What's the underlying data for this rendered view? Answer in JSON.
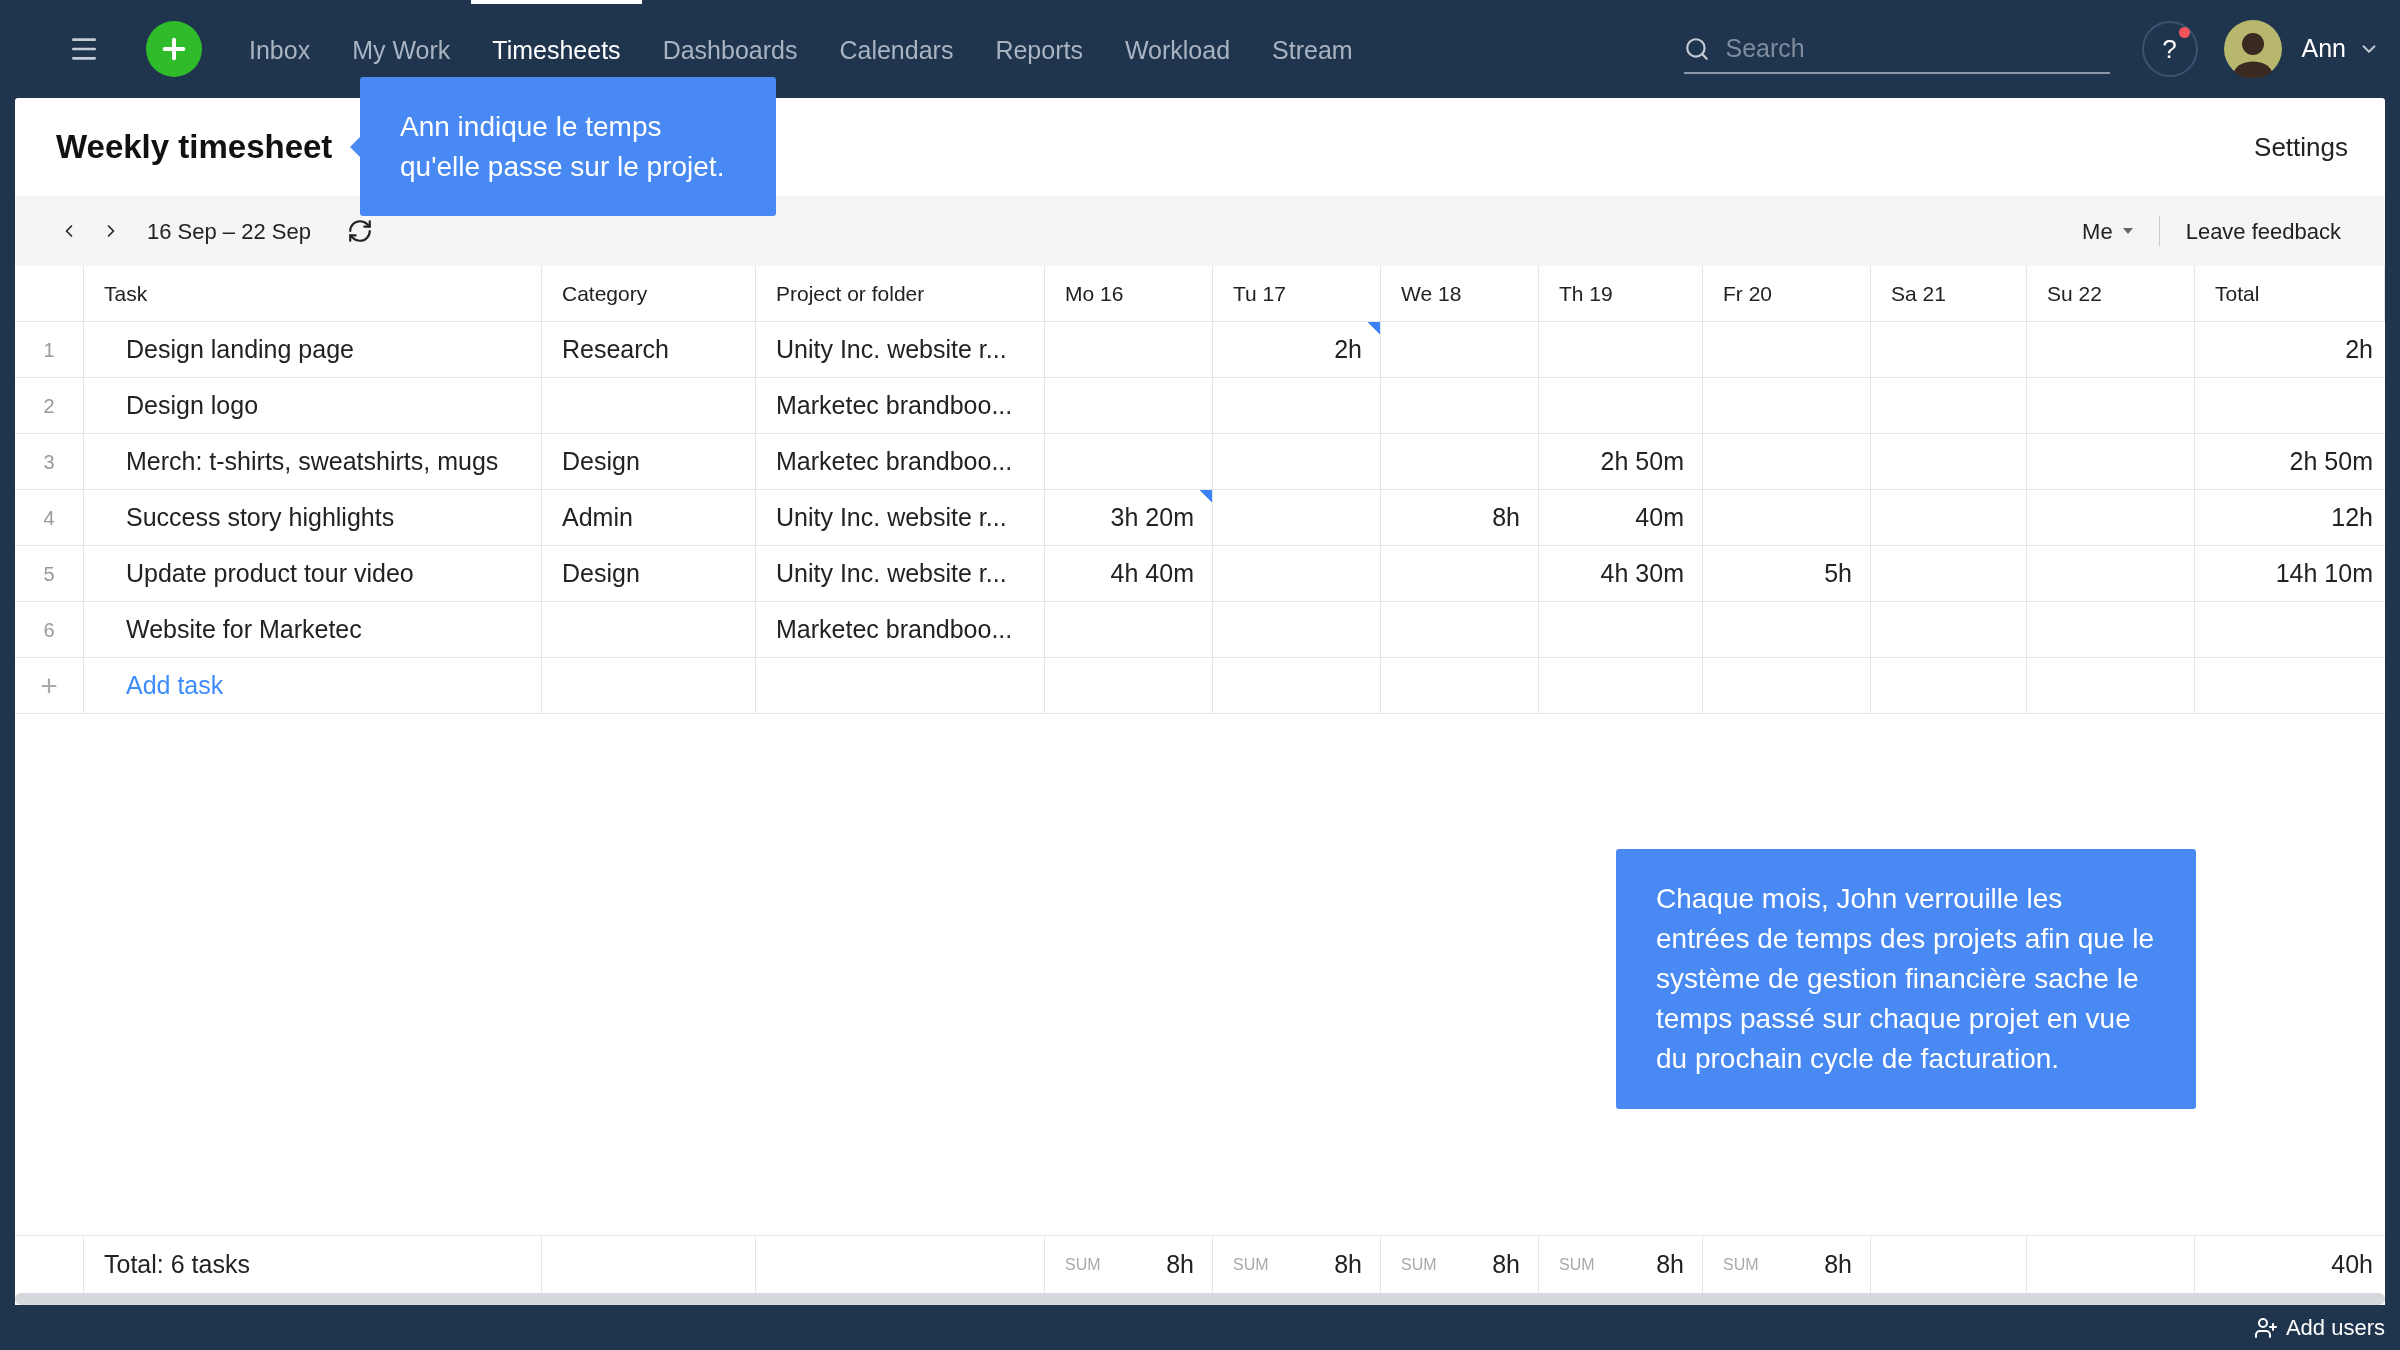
{
  "nav": {
    "tabs": [
      {
        "label": "Inbox",
        "selected": false
      },
      {
        "label": "My Work",
        "selected": false
      },
      {
        "label": "Timesheets",
        "selected": true
      },
      {
        "label": "Dashboards",
        "selected": false
      },
      {
        "label": "Calendars",
        "selected": false
      },
      {
        "label": "Reports",
        "selected": false
      },
      {
        "label": "Workload",
        "selected": false
      },
      {
        "label": "Stream",
        "selected": false
      }
    ],
    "search": {
      "placeholder": "Search"
    },
    "help": {
      "label": "?",
      "notification": true
    },
    "user": {
      "name": "Ann"
    }
  },
  "header": {
    "title": "Weekly timesheet",
    "settings": "Settings"
  },
  "toolbar": {
    "range": "16 Sep – 22 Sep",
    "filter": "Me",
    "feedback": "Leave feedback"
  },
  "table": {
    "columns": [
      "Task",
      "Category",
      "Project or folder",
      "Mo 16",
      "Tu 17",
      "We 18",
      "Th 19",
      "Fr 20",
      "Sa 21",
      "Su 22",
      "Total"
    ],
    "rows": [
      {
        "number": "1",
        "task": "Design landing page",
        "category": "Research",
        "project": "Unity Inc. website r...",
        "days": [
          {
            "marked": false
          },
          {
            "value": "2h",
            "marked": true
          },
          {
            "marked": false
          },
          {
            "marked": false
          },
          {
            "marked": false
          },
          {
            "marked": false
          },
          {
            "marked": false
          }
        ],
        "total": "2h"
      },
      {
        "number": "2",
        "task": "Design logo",
        "project": "Marketec brandboo...",
        "days": [
          {
            "marked": false
          },
          {
            "marked": false
          },
          {
            "marked": false
          },
          {
            "marked": false
          },
          {
            "marked": false
          },
          {
            "marked": false
          },
          {
            "marked": false
          }
        ]
      },
      {
        "number": "3",
        "task": "Merch: t-shirts, sweatshirts, mugs",
        "category": "Design",
        "project": "Marketec brandboo...",
        "days": [
          {
            "marked": false
          },
          {
            "marked": false
          },
          {
            "marked": false
          },
          {
            "value": "2h 50m",
            "marked": false
          },
          {
            "marked": false
          },
          {
            "marked": false
          },
          {
            "marked": false
          }
        ],
        "total": "2h 50m"
      },
      {
        "number": "4",
        "task": "Success story highlights",
        "category": "Admin",
        "project": "Unity Inc. website r...",
        "days": [
          {
            "value": "3h 20m",
            "marked": true
          },
          {
            "marked": false
          },
          {
            "value": "8h",
            "marked": false
          },
          {
            "value": "40m",
            "marked": false
          },
          {
            "marked": false
          },
          {
            "marked": false
          },
          {
            "marked": false
          }
        ],
        "total": "12h"
      },
      {
        "number": "5",
        "task": "Update product tour video",
        "category": "Design",
        "project": "Unity Inc. website r...",
        "days": [
          {
            "value": "4h 40m",
            "marked": false
          },
          {
            "marked": false
          },
          {
            "marked": false
          },
          {
            "value": "4h 30m",
            "marked": false
          },
          {
            "value": "5h",
            "marked": false
          },
          {
            "marked": false
          },
          {
            "marked": false
          }
        ],
        "total": "14h 10m"
      },
      {
        "number": "6",
        "task": "Website for Marketec",
        "project": "Marketec brandboo...",
        "days": [
          {
            "marked": false
          },
          {
            "marked": false
          },
          {
            "marked": false
          },
          {
            "marked": false
          },
          {
            "marked": false
          },
          {
            "marked": false
          },
          {
            "marked": false
          }
        ]
      }
    ],
    "add_task": {
      "icon": "+",
      "label": "Add task"
    },
    "footer": {
      "label": "Total: 6 tasks",
      "days": [
        {
          "caption": "SUM",
          "value": "8h"
        },
        {
          "caption": "SUM",
          "value": "8h"
        },
        {
          "caption": "SUM",
          "value": "8h"
        },
        {
          "caption": "SUM",
          "value": "8h"
        },
        {
          "caption": "SUM",
          "value": "8h"
        }
      ],
      "total": "40h"
    }
  },
  "callouts": [
    {
      "kind": "left",
      "text": "Ann indique le temps qu'elle passe sur le projet."
    },
    {
      "kind": "plain",
      "text": "Chaque mois, John verrouille les entrées de temps des projets afin que le système de gestion financière sache le temps passé sur chaque projet en vue du prochain cycle de facturation."
    }
  ],
  "bottom_bar": {
    "add_users": "Add users"
  }
}
